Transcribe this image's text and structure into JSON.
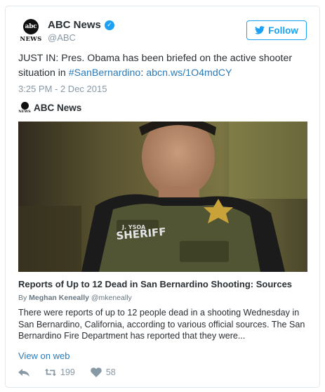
{
  "author": {
    "display_name": "ABC News",
    "handle": "@ABC",
    "avatar_disc_text": "abc",
    "avatar_wordmark": "NEWS",
    "verified_icon": "verified-check-icon"
  },
  "follow_button": {
    "label": "Follow",
    "icon": "twitter-bird-icon"
  },
  "tweet": {
    "text_prefix": "JUST IN: Pres. Obama has been briefed on the active shooter situation in ",
    "hashtag": "#SanBernardino",
    "text_middle": ": ",
    "link": "abcn.ws/1O4mdCY",
    "timestamp": "3:25 PM - 2 Dec 2015"
  },
  "card": {
    "source_name": "ABC News",
    "image_badge_text": "J. YSOA",
    "image_vest_text": "SHERIFF",
    "title": "Reports of Up to 12 Dead in San Bernardino Shooting: Sources",
    "byline_prefix": "By ",
    "byline_author": "Meghan Keneally",
    "byline_handle": " @mkeneally",
    "description": "There were reports of up to 12 people dead in a shooting Wednesday in San Bernardino, California, according to various official sources. The San Bernardino Fire Department has reported that they were...",
    "view_on_web": "View on web"
  },
  "actions": {
    "reply_icon": "reply-icon",
    "retweet_icon": "retweet-icon",
    "retweet_count": "199",
    "like_icon": "heart-icon",
    "like_count": "58"
  },
  "colors": {
    "link": "#2b7bb9",
    "brand_blue": "#1da1f2",
    "muted": "#8899a6",
    "text": "#292f33"
  }
}
